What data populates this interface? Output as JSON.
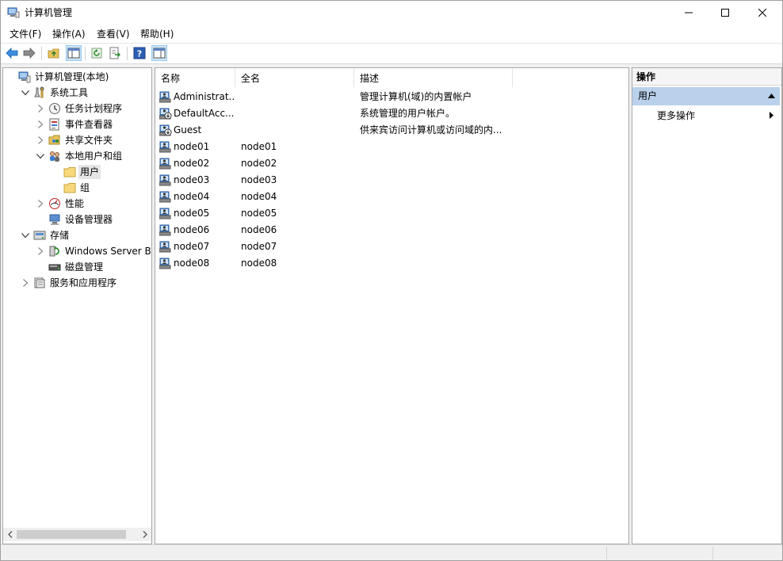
{
  "window": {
    "title": "计算机管理"
  },
  "menu": [
    "文件(F)",
    "操作(A)",
    "查看(V)",
    "帮助(H)"
  ],
  "tree": [
    {
      "label": "计算机管理(本地)",
      "icon": "computer-management-icon",
      "level": 0,
      "expander": "none"
    },
    {
      "label": "系统工具",
      "icon": "system-tools-icon",
      "level": 1,
      "expander": "expanded"
    },
    {
      "label": "任务计划程序",
      "icon": "task-scheduler-icon",
      "level": 2,
      "expander": "collapsed"
    },
    {
      "label": "事件查看器",
      "icon": "event-viewer-icon",
      "level": 2,
      "expander": "collapsed"
    },
    {
      "label": "共享文件夹",
      "icon": "shared-folders-icon",
      "level": 2,
      "expander": "collapsed"
    },
    {
      "label": "本地用户和组",
      "icon": "local-users-groups-icon",
      "level": 2,
      "expander": "expanded"
    },
    {
      "label": "用户",
      "icon": "folder-icon",
      "level": 3,
      "expander": "none",
      "selected": true
    },
    {
      "label": "组",
      "icon": "folder-icon",
      "level": 3,
      "expander": "none"
    },
    {
      "label": "性能",
      "icon": "performance-icon",
      "level": 2,
      "expander": "collapsed"
    },
    {
      "label": "设备管理器",
      "icon": "device-manager-icon",
      "level": 2,
      "expander": "none"
    },
    {
      "label": "存储",
      "icon": "storage-icon",
      "level": 1,
      "expander": "expanded"
    },
    {
      "label": "Windows Server Backup",
      "icon": "server-backup-icon",
      "level": 2,
      "expander": "collapsed"
    },
    {
      "label": "磁盘管理",
      "icon": "disk-management-icon",
      "level": 2,
      "expander": "none"
    },
    {
      "label": "服务和应用程序",
      "icon": "services-apps-icon",
      "level": 1,
      "expander": "collapsed"
    }
  ],
  "list": {
    "columns": [
      "名称",
      "全名",
      "描述"
    ],
    "rows": [
      {
        "name": "Administrat...",
        "full_name": "",
        "description": "管理计算机(域)的内置帐户",
        "icon": "user-icon"
      },
      {
        "name": "DefaultAcc...",
        "full_name": "",
        "description": "系统管理的用户帐户。",
        "icon": "disabled-user-icon"
      },
      {
        "name": "Guest",
        "full_name": "",
        "description": "供来宾访问计算机或访问域的内...",
        "icon": "disabled-user-icon"
      },
      {
        "name": "node01",
        "full_name": "node01",
        "description": "",
        "icon": "user-icon"
      },
      {
        "name": "node02",
        "full_name": "node02",
        "description": "",
        "icon": "user-icon"
      },
      {
        "name": "node03",
        "full_name": "node03",
        "description": "",
        "icon": "user-icon"
      },
      {
        "name": "node04",
        "full_name": "node04",
        "description": "",
        "icon": "user-icon"
      },
      {
        "name": "node05",
        "full_name": "node05",
        "description": "",
        "icon": "user-icon"
      },
      {
        "name": "node06",
        "full_name": "node06",
        "description": "",
        "icon": "user-icon"
      },
      {
        "name": "node07",
        "full_name": "node07",
        "description": "",
        "icon": "user-icon"
      },
      {
        "name": "node08",
        "full_name": "node08",
        "description": "",
        "icon": "user-icon"
      }
    ]
  },
  "actions": {
    "header": "操作",
    "section": "用户",
    "more": "更多操作"
  },
  "colors": {
    "selection_blue": "#b9d1ea",
    "accent": "#0078d7"
  }
}
